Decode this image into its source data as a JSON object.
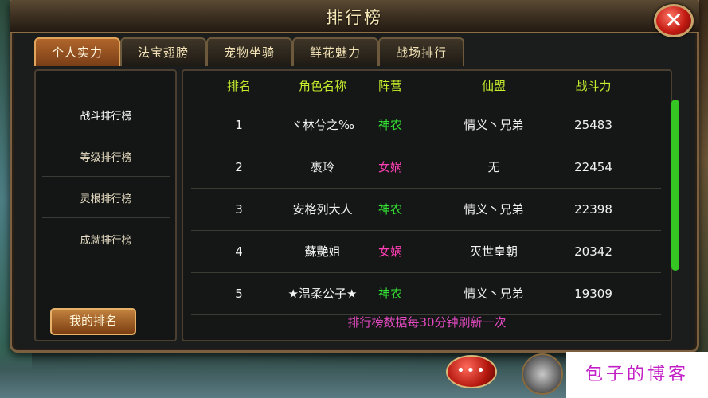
{
  "window": {
    "title": "排行榜",
    "close_label": "✕"
  },
  "tabs": [
    {
      "label": "个人实力",
      "active": true
    },
    {
      "label": "法宝翅膀",
      "active": false
    },
    {
      "label": "宠物坐骑",
      "active": false
    },
    {
      "label": "鲜花魅力",
      "active": false
    },
    {
      "label": "战场排行",
      "active": false
    }
  ],
  "sidebar": {
    "items": [
      {
        "label": "战斗排行榜",
        "selected": true
      },
      {
        "label": "等级排行榜",
        "selected": false
      },
      {
        "label": "灵根排行榜",
        "selected": false
      },
      {
        "label": "成就排行榜",
        "selected": false
      }
    ],
    "my_rank_label": "我的排名"
  },
  "table": {
    "headers": {
      "rank": "排名",
      "name": "角色名称",
      "faction": "阵营",
      "guild": "仙盟",
      "power": "战斗力"
    },
    "rows": [
      {
        "rank": "1",
        "name": "ヾ林兮之‰",
        "faction": "神农",
        "guild": "情义丶兄弟",
        "power": "25483"
      },
      {
        "rank": "2",
        "name": "褭玲",
        "faction": "女娲",
        "guild": "无",
        "power": "22454"
      },
      {
        "rank": "3",
        "name": "安格列大人",
        "faction": "神农",
        "guild": "情义丶兄弟",
        "power": "22398"
      },
      {
        "rank": "4",
        "name": "蘇艷姐",
        "faction": "女娲",
        "guild": "灭世皇朝",
        "power": "20342"
      },
      {
        "rank": "5",
        "name": "★温柔公子★",
        "faction": "神农",
        "guild": "情义丶兄弟",
        "power": "19309"
      }
    ],
    "footer_note": "排行榜数据每30分钟刷新一次"
  },
  "colors": {
    "header_text": "#c6ee2e",
    "faction_shennong": "#33e033",
    "faction_nvwa": "#ff3fb5",
    "footer_note": "#e24ac0",
    "scroll_thumb": "#35c624"
  },
  "bottom": {
    "chat_label": "•••",
    "watermark": "包子的博客"
  }
}
